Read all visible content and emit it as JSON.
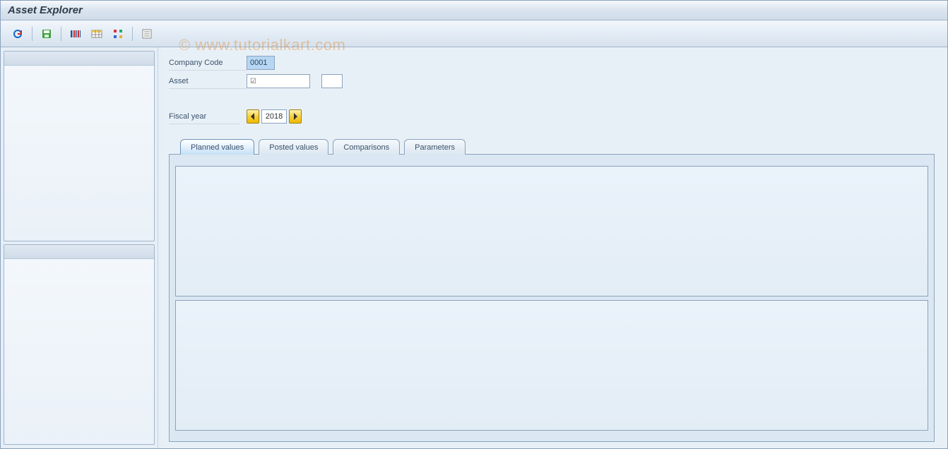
{
  "title": "Asset Explorer",
  "watermark": "© www.tutorialkart.com",
  "toolbar": {
    "icons": [
      "refresh-icon",
      "save-icon",
      "grid-icon",
      "table-icon",
      "dots-icon",
      "list-icon"
    ]
  },
  "fields": {
    "company_code_label": "Company Code",
    "company_code_value": "0001",
    "asset_label": "Asset",
    "asset_value": "",
    "asset_sub_value": "",
    "fiscal_year_label": "Fiscal year",
    "fiscal_year_value": "2018"
  },
  "tabs": [
    {
      "id": "planned",
      "label": "Planned values",
      "active": true
    },
    {
      "id": "posted",
      "label": "Posted values",
      "active": false
    },
    {
      "id": "comparisons",
      "label": "Comparisons",
      "active": false
    },
    {
      "id": "parameters",
      "label": "Parameters",
      "active": false
    }
  ]
}
